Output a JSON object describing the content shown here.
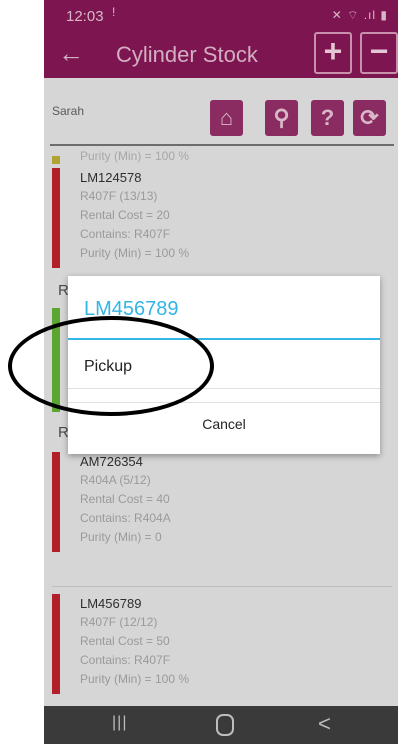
{
  "status": {
    "time": "12:03",
    "notification": "!",
    "system_icons": "✕ ⌔ .ıl ▮"
  },
  "app_bar": {
    "title": "Cylinder Stock",
    "plus": "+",
    "minus": "−",
    "back": "←"
  },
  "toolbar": {
    "user": "Sarah",
    "home": "⌂",
    "search": "⚲",
    "help": "?",
    "refresh": "⟳"
  },
  "list": {
    "cut_top": "Purity (Min) = 100 %",
    "group_letter_1": "R",
    "group_letter_2": "R",
    "cards": [
      {
        "code": "LM124578",
        "refrigerant": "R407F (13/13)",
        "rental": "Rental Cost = 20",
        "contains": "Contains: R407F",
        "purity": "Purity (Min) = 100 %",
        "color": "#b01f2a"
      },
      {
        "code": "AM726354",
        "refrigerant": "R404A (5/12)",
        "rental": "Rental Cost = 40",
        "contains": "Contains: R404A",
        "purity": "Purity (Min) = 0",
        "color": "#b01f2a"
      },
      {
        "code": "LM456789",
        "refrigerant": "R407F (12/12)",
        "rental": "Rental Cost = 50",
        "contains": "Contains: R407F",
        "purity": "Purity (Min) = 100 %",
        "color": "#b01f2a"
      }
    ]
  },
  "dialog": {
    "title": "LM456789",
    "item": "Pickup",
    "cancel": "Cancel"
  },
  "navbar": {
    "recent": "|||",
    "back": "<"
  },
  "colors": {
    "primary": "#7d1650",
    "accent": "#33b5e5",
    "stripe_red": "#b01f2a",
    "stripe_green": "#5aa631"
  }
}
